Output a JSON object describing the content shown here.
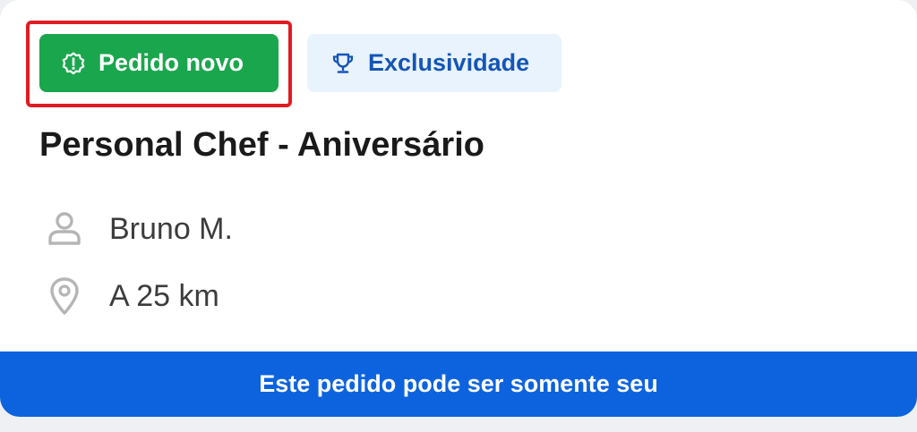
{
  "tags": {
    "new_order": {
      "label": "Pedido novo",
      "icon": "alert-badge-icon",
      "color": "#1aa64d"
    },
    "exclusivity": {
      "label": "Exclusividade",
      "icon": "trophy-icon",
      "color": "#1555b7"
    }
  },
  "title": "Personal Chef - Aniversário",
  "customer": {
    "name": "Bruno M.",
    "icon": "person-icon"
  },
  "distance": {
    "text": "A 25 km",
    "icon": "map-pin-icon"
  },
  "banner": {
    "text": "Este pedido pode ser somente seu",
    "color": "#0c63dd"
  },
  "highlight_color": "#e11b22"
}
